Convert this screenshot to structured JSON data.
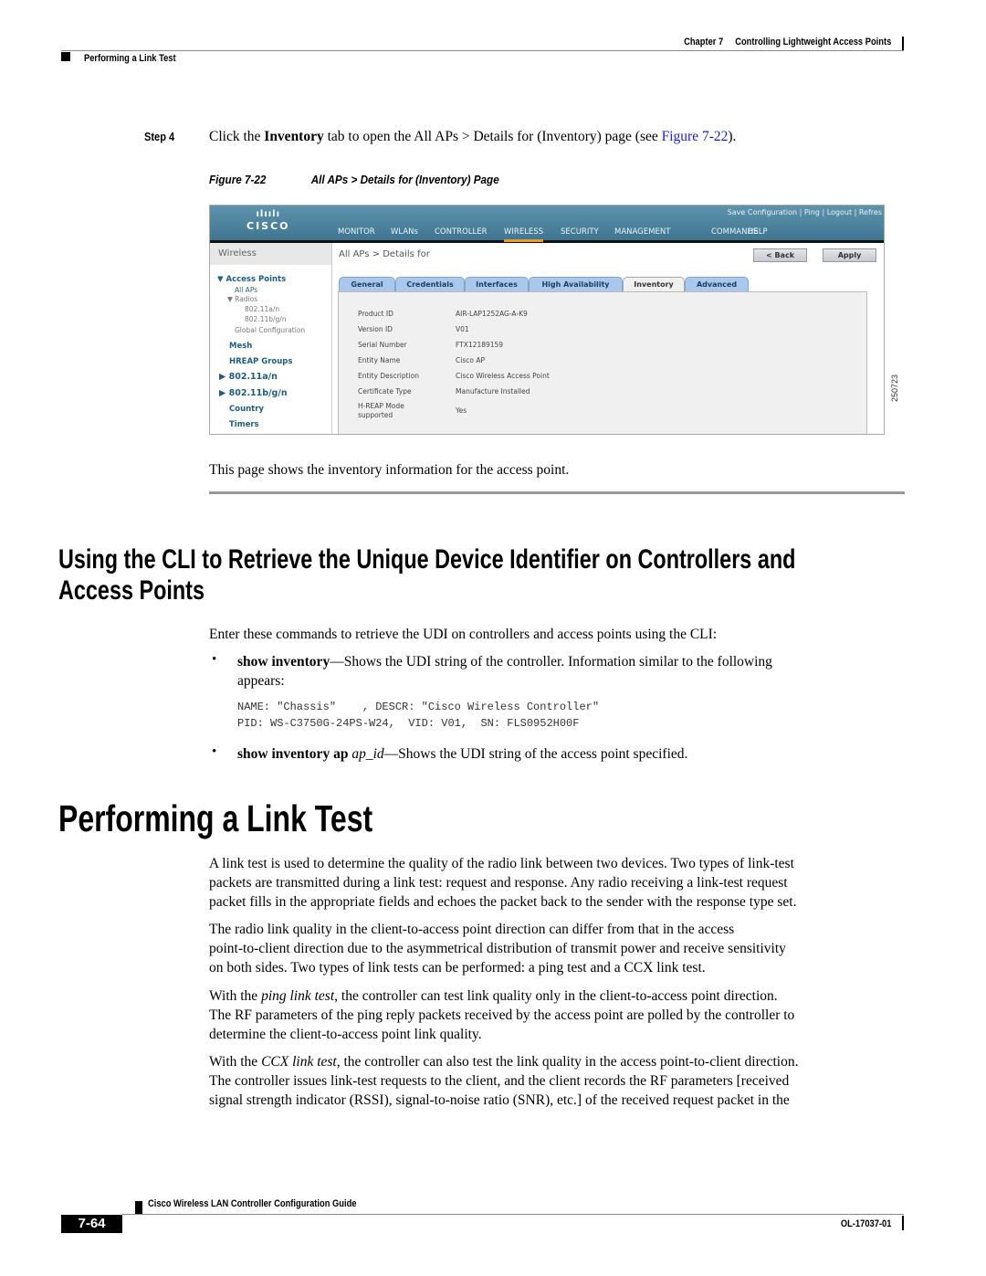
{
  "header": {
    "chapter": "Chapter 7",
    "chapter_title": "Controlling Lightweight Access Points",
    "section": "Performing a Link Test"
  },
  "step": {
    "label": "Step 4",
    "text_before": "Click the ",
    "bold": "Inventory",
    "text_after": " tab to open the All APs > Details for (Inventory) page (see ",
    "link": "Figure 7-22",
    "text_end": ")."
  },
  "figure": {
    "label": "Figure 7-22",
    "caption": "All APs > Details for (Inventory) Page",
    "id_number": "250723",
    "screenshot": {
      "logo_bars": "ılıılı",
      "logo_text": "CISCO",
      "top_links": "Save Configuration  |  Ping  |  Logout | Refres",
      "nav": [
        "MONITOR",
        "WLANs",
        "CONTROLLER",
        "WIRELESS",
        "SECURITY",
        "MANAGEMENT",
        "COMMANDS",
        "HELP"
      ],
      "active_nav": "WIRELESS",
      "sidebar_title": "Wireless",
      "sidebar": {
        "access_points": "▼ Access Points",
        "all_aps": "All APs",
        "radios": "▼ Radios",
        "radio_a": "802.11a/n",
        "radio_bg": "802.11b/g/n",
        "global_config": "Global Configuration",
        "mesh": "Mesh",
        "hreap": "HREAP Groups",
        "band_a": "▶ 802.11a/n",
        "band_bg": "▶ 802.11b/g/n",
        "country": "Country",
        "timers": "Timers"
      },
      "content_title": "All APs > Details for",
      "back_button": "< Back",
      "apply_button": "Apply",
      "tabs": [
        "General",
        "Credentials",
        "Interfaces",
        "High Availability",
        "Inventory",
        "Advanced"
      ],
      "active_tab": "Inventory",
      "fields": [
        {
          "label": "Product ID",
          "value": "AIR-LAP1252AG-A-K9"
        },
        {
          "label": "Version ID",
          "value": "V01"
        },
        {
          "label": "Serial Number",
          "value": "FTX12189159"
        },
        {
          "label": "Entity Name",
          "value": "Cisco AP"
        },
        {
          "label": "Entity Description",
          "value": "Cisco Wireless Access Point"
        },
        {
          "label": "Certificate Type",
          "value": "Manufacture Installed"
        },
        {
          "label": "H-REAP Mode",
          "label2": "supported",
          "value": "Yes"
        }
      ]
    }
  },
  "figure_note": "This page shows the inventory information for the access point.",
  "section_cli": {
    "title_line1": "Using the CLI to Retrieve the Unique Device Identifier on Controllers and",
    "title_line2": "Access Points",
    "intro": "Enter these commands to retrieve the UDI on controllers and access points using the CLI:",
    "bullet1_cmd": "show inventory",
    "bullet1_text_line1": "—Shows the UDI string of the controller. Information similar to the following",
    "bullet1_text_line2": "appears:",
    "code_line1": "NAME: \"Chassis\"    , DESCR: \"Cisco Wireless Controller\"",
    "code_line2": "PID: WS-C3750G-24PS-W24,  VID: V01,  SN: FLS0952H00F",
    "bullet2_cmd": "show inventory ap",
    "bullet2_arg": "ap_id",
    "bullet2_text": "—Shows the UDI string of the access point specified.",
    "bullet_char": "•"
  },
  "section_link": {
    "title": "Performing a Link Test",
    "p1": [
      "A link test is used to determine the quality of the radio link between two devices. Two types of link-test",
      "packets are transmitted during a link test: request and response. Any radio receiving a link-test request",
      "packet fills in the appropriate fields and echoes the packet back to the sender with the response type set."
    ],
    "p2": [
      "The radio link quality in the client-to-access point direction can differ from that in the access",
      "point-to-client direction due to the asymmetrical distribution of transmit power and receive sensitivity",
      "on both sides. Two types of link tests can be performed: a ping test and a CCX link test."
    ],
    "p3_pre": "With the ",
    "p3_em": "ping link test",
    "p3_l1": ", the controller can test link quality only in the client-to-access point direction.",
    "p3_l2": "The RF parameters of the ping reply packets received by the access point are polled by the controller to",
    "p3_l3": "determine the client-to-access point link quality.",
    "p4_pre": "With the ",
    "p4_em": "CCX link test",
    "p4_l1": ", the controller can also test the link quality in the access point-to-client direction.",
    "p4_l2": "The controller issues link-test requests to the client, and the client records the RF parameters [received",
    "p4_l3": "signal strength indicator (RSSI), signal-to-noise ratio (SNR), etc.] of the received request packet in the"
  },
  "footer": {
    "guide_title": "Cisco Wireless LAN Controller Configuration Guide",
    "page_number": "7-64",
    "doc_number": "OL-17037-01"
  }
}
